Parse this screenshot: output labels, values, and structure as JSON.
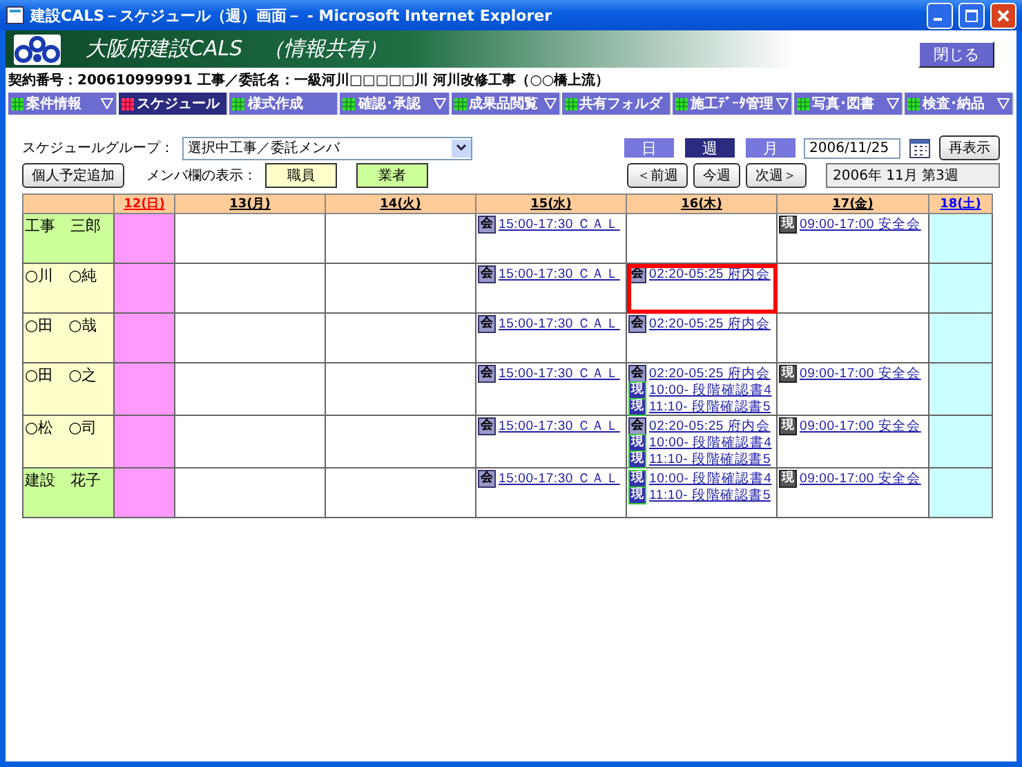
{
  "window": {
    "title": "建設CALS－スケジュール（週）画面－ - Microsoft Internet Explorer"
  },
  "header": {
    "title": "大阪府建設CALS　（情報共有）",
    "close_button": "閉じる",
    "contract": "契約番号：200610999991 工事／委託名：一級河川□□□□□川 河川改修工事（○○橋上流）"
  },
  "menu": {
    "items": [
      {
        "label": "案件情報",
        "selected": false,
        "has_dropdown": true
      },
      {
        "label": "スケジュール",
        "selected": true,
        "has_dropdown": false
      },
      {
        "label": "様式作成",
        "selected": false,
        "has_dropdown": false
      },
      {
        "label": "確認･承認",
        "selected": false,
        "has_dropdown": true
      },
      {
        "label": "成果品閲覧",
        "selected": false,
        "has_dropdown": true
      },
      {
        "label": "共有フォルダ",
        "selected": false,
        "has_dropdown": false
      },
      {
        "label": "施工ﾃﾞｰﾀ管理",
        "selected": false,
        "has_dropdown": true
      },
      {
        "label": "写真･図書",
        "selected": false,
        "has_dropdown": true
      },
      {
        "label": "検査･納品",
        "selected": false,
        "has_dropdown": true
      }
    ]
  },
  "toolbar": {
    "group_label": "スケジュールグループ：",
    "group_value": "選択中工事／委託メンバ",
    "views": [
      {
        "label": "日",
        "selected": false
      },
      {
        "label": "週",
        "selected": true
      },
      {
        "label": "月",
        "selected": false
      }
    ],
    "date": "2006/11/25",
    "refresh_button": "再表示",
    "add_button": "個人予定追加",
    "member_label": "メンバ欄の表示：",
    "legend": [
      {
        "label": "職員",
        "kind": "staff"
      },
      {
        "label": "業者",
        "kind": "contractor"
      }
    ],
    "nav_buttons": [
      "＜前週",
      "今週",
      "次週＞"
    ],
    "week": "2006年 11月 第3週"
  },
  "schedule": {
    "days": [
      {
        "label": "12(日)",
        "kind": "sunday"
      },
      {
        "label": "13(月)",
        "kind": "weekday"
      },
      {
        "label": "14(火)",
        "kind": "weekday"
      },
      {
        "label": "15(水)",
        "kind": "weekday"
      },
      {
        "label": "16(木)",
        "kind": "weekday"
      },
      {
        "label": "17(金)",
        "kind": "weekday"
      },
      {
        "label": "18(土)",
        "kind": "saturday"
      }
    ],
    "members": [
      {
        "name": "工事　三郎",
        "kind": "contractor",
        "cells": [
          {
            "highlighted": false
          },
          {
            "highlighted": false
          },
          {
            "highlighted": false
          },
          {
            "highlighted": false,
            "events": [
              {
                "badge": "会",
                "kind": "meeting",
                "text": "15:00-17:30 ＣＡＬ"
              }
            ]
          },
          {
            "highlighted": false
          },
          {
            "highlighted": false,
            "events": [
              {
                "badge": "現",
                "kind": "site",
                "text": "09:00-17:00 安全会"
              }
            ]
          },
          {
            "highlighted": false
          }
        ]
      },
      {
        "name": "○川　○純",
        "kind": "staff",
        "cells": [
          {
            "highlighted": false
          },
          {
            "highlighted": false
          },
          {
            "highlighted": false
          },
          {
            "highlighted": false,
            "events": [
              {
                "badge": "会",
                "kind": "meeting",
                "text": "15:00-17:30 ＣＡＬ"
              }
            ]
          },
          {
            "highlighted": true,
            "events": [
              {
                "badge": "会",
                "kind": "meeting",
                "text": "02:20-05:25 府内会"
              }
            ]
          },
          {
            "highlighted": false
          },
          {
            "highlighted": false
          }
        ]
      },
      {
        "name": "○田　○哉",
        "kind": "staff",
        "cells": [
          {
            "highlighted": false
          },
          {
            "highlighted": false
          },
          {
            "highlighted": false
          },
          {
            "highlighted": false,
            "events": [
              {
                "badge": "会",
                "kind": "meeting",
                "text": "15:00-17:30 ＣＡＬ"
              }
            ]
          },
          {
            "highlighted": false,
            "events": [
              {
                "badge": "会",
                "kind": "meeting",
                "text": "02:20-05:25 府内会"
              }
            ]
          },
          {
            "highlighted": false
          },
          {
            "highlighted": false
          }
        ]
      },
      {
        "name": "○田　○之",
        "kind": "staff",
        "cells": [
          {
            "highlighted": false
          },
          {
            "highlighted": false
          },
          {
            "highlighted": false
          },
          {
            "highlighted": false,
            "events": [
              {
                "badge": "会",
                "kind": "meeting",
                "text": "15:00-17:30 ＣＡＬ"
              }
            ]
          },
          {
            "highlighted": false,
            "events": [
              {
                "badge": "会",
                "kind": "meeting",
                "text": "02:20-05:25 府内会"
              },
              {
                "badge": "現",
                "kind": "inspection",
                "text": "10:00- 段階確認書4"
              },
              {
                "badge": "現",
                "kind": "inspection",
                "text": "11:10- 段階確認書5"
              }
            ]
          },
          {
            "highlighted": false,
            "events": [
              {
                "badge": "現",
                "kind": "site",
                "text": "09:00-17:00 安全会"
              }
            ]
          },
          {
            "highlighted": false
          }
        ]
      },
      {
        "name": "○松　○司",
        "kind": "staff",
        "cells": [
          {
            "highlighted": false
          },
          {
            "highlighted": false
          },
          {
            "highlighted": false
          },
          {
            "highlighted": false,
            "events": [
              {
                "badge": "会",
                "kind": "meeting",
                "text": "15:00-17:30 ＣＡＬ"
              }
            ]
          },
          {
            "highlighted": false,
            "events": [
              {
                "badge": "会",
                "kind": "meeting",
                "text": "02:20-05:25 府内会"
              },
              {
                "badge": "現",
                "kind": "inspection",
                "text": "10:00- 段階確認書4"
              },
              {
                "badge": "現",
                "kind": "inspection",
                "text": "11:10- 段階確認書5"
              }
            ]
          },
          {
            "highlighted": false,
            "events": [
              {
                "badge": "現",
                "kind": "site",
                "text": "09:00-17:00 安全会"
              }
            ]
          },
          {
            "highlighted": false
          }
        ]
      },
      {
        "name": "建設　花子",
        "kind": "contractor",
        "cells": [
          {
            "highlighted": false
          },
          {
            "highlighted": false
          },
          {
            "highlighted": false
          },
          {
            "highlighted": false,
            "events": [
              {
                "badge": "会",
                "kind": "meeting",
                "text": "15:00-17:30 ＣＡＬ"
              }
            ]
          },
          {
            "highlighted": false,
            "events": [
              {
                "badge": "現",
                "kind": "inspection",
                "text": "10:00- 段階確認書4"
              },
              {
                "badge": "現",
                "kind": "inspection",
                "text": "11:10- 段階確認書5"
              }
            ]
          },
          {
            "highlighted": false,
            "events": [
              {
                "badge": "現",
                "kind": "site",
                "text": "09:00-17:00 安全会"
              }
            ]
          },
          {
            "highlighted": false
          }
        ]
      }
    ]
  }
}
